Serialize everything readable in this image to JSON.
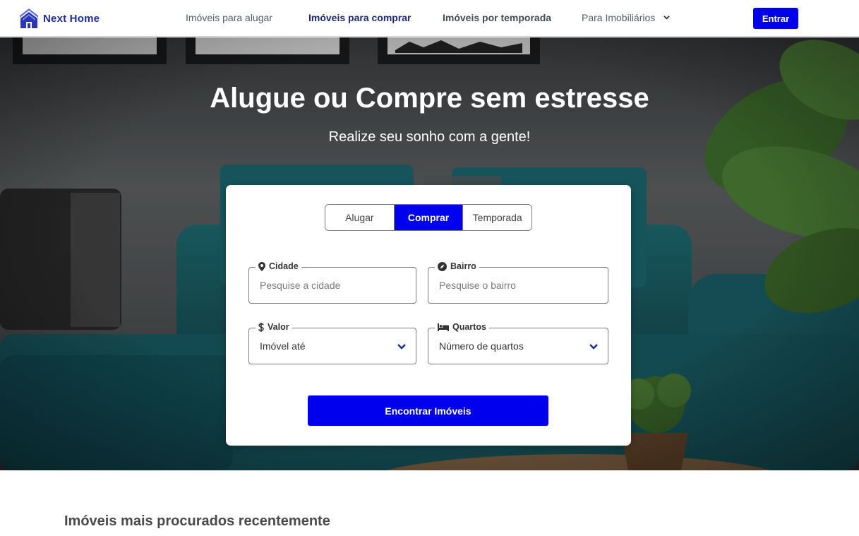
{
  "brand": {
    "name": "Next Home",
    "color": "#1e2b9e"
  },
  "nav": {
    "items": [
      {
        "label": "Imóveis para alugar"
      },
      {
        "label": "Imóveis para comprar"
      },
      {
        "label": "Imóveis por temporada"
      },
      {
        "label": "Para Imobiliários"
      }
    ],
    "active": "Imóveis para comprar",
    "login_label": "Entrar"
  },
  "hero": {
    "title": "Alugue ou Compre sem estresse",
    "subtitle": "Realize seu sonho com a gente!"
  },
  "search": {
    "tabs": [
      {
        "label": "Alugar"
      },
      {
        "label": "Comprar"
      },
      {
        "label": "Temporada"
      }
    ],
    "active_tab": "Comprar",
    "fields": {
      "city": {
        "label": "Cidade",
        "placeholder": "Pesquise a cidade",
        "icon": "map-pin-icon"
      },
      "neighborhood": {
        "label": "Bairro",
        "placeholder": "Pesquise o bairro",
        "icon": "compass-icon"
      },
      "price": {
        "label": "Valor",
        "value": "Imóvel até",
        "icon": "dollar-icon"
      },
      "rooms": {
        "label": "Quartos",
        "value": "Número de quartos",
        "icon": "bed-icon"
      }
    },
    "submit_label": "Encontrar Imóveis"
  },
  "sections": {
    "recent_title": "Imóveis mais procurados recentemente"
  },
  "colors": {
    "accent": "#0000ee",
    "nav_active": "#1e2878"
  }
}
